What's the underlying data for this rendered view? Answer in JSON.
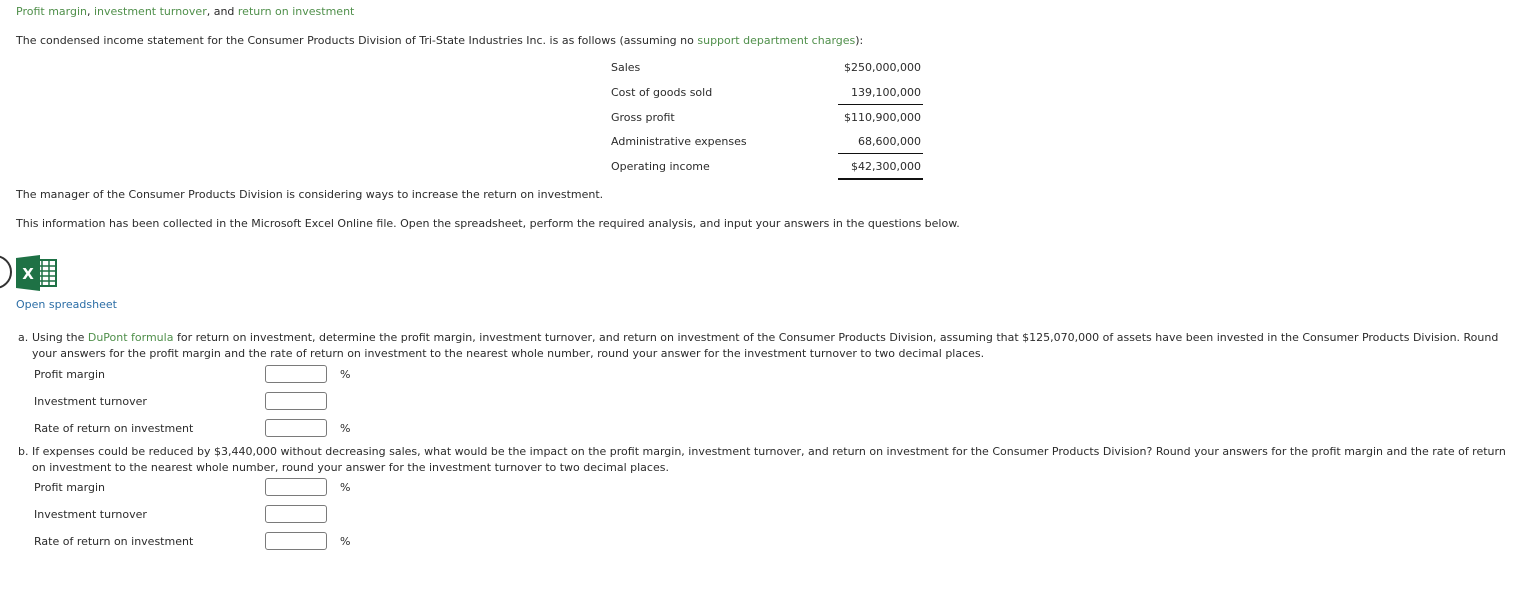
{
  "header": {
    "title_parts": [
      {
        "text": "Profit margin",
        "link": true
      },
      {
        "text": ", ",
        "link": false
      },
      {
        "text": "investment turnover",
        "link": true
      },
      {
        "text": ", and ",
        "link": false
      },
      {
        "text": "return on investment",
        "link": true
      }
    ]
  },
  "intro": {
    "before": "The condensed income statement for the Consumer Products Division of Tri-State Industries Inc. is as follows (assuming no ",
    "link": "support department charges",
    "after": "):"
  },
  "income_statement": {
    "rows": [
      {
        "label": "Sales",
        "value": "$250,000,000"
      },
      {
        "label": "Cost of goods sold",
        "value": "139,100,000"
      },
      {
        "label": "Gross profit",
        "value": "$110,900,000"
      },
      {
        "label": "Administrative expenses",
        "value": "68,600,000"
      },
      {
        "label": "Operating income",
        "value": "$42,300,000"
      }
    ]
  },
  "paragraphs": {
    "manager": "The manager of the Consumer Products Division is considering ways to increase the return on investment.",
    "info": "This information has been collected in the Microsoft Excel Online file. Open the spreadsheet, perform the required analysis, and input your answers in the questions below."
  },
  "spreadsheet": {
    "icon": "excel-icon",
    "link_label": "Open spreadsheet",
    "colors": {
      "excel_green": "#1e7145",
      "link_blue": "#2c6ea6"
    }
  },
  "questions": {
    "a": {
      "marker": "a.",
      "before": "Using the ",
      "link": "DuPont formula",
      "after": " for return on investment, determine the profit margin, investment turnover, and return on investment of the Consumer Products Division, assuming that $125,070,000 of assets have been invested in the Consumer Products Division. Round your answers for the profit margin and the rate of return on investment to the nearest whole number, round your answer for the investment turnover to two decimal places.",
      "fields": [
        {
          "label": "Profit margin",
          "value": "",
          "unit": "%"
        },
        {
          "label": "Investment turnover",
          "value": "",
          "unit": ""
        },
        {
          "label": "Rate of return on investment",
          "value": "",
          "unit": "%"
        }
      ]
    },
    "b": {
      "marker": "b.",
      "text": "If expenses could be reduced by $3,440,000 without decreasing sales, what would be the impact on the profit margin, investment turnover, and return on investment for the Consumer Products Division? Round your answers for the profit margin and the rate of return on investment to the nearest whole number, round your answer for the investment turnover to two decimal places.",
      "fields": [
        {
          "label": "Profit margin",
          "value": "",
          "unit": "%"
        },
        {
          "label": "Investment turnover",
          "value": "",
          "unit": ""
        },
        {
          "label": "Rate of return on investment",
          "value": "",
          "unit": "%"
        }
      ]
    }
  },
  "colors": {
    "green_link": "#4f8f4a",
    "text": "#2b2b2b"
  }
}
